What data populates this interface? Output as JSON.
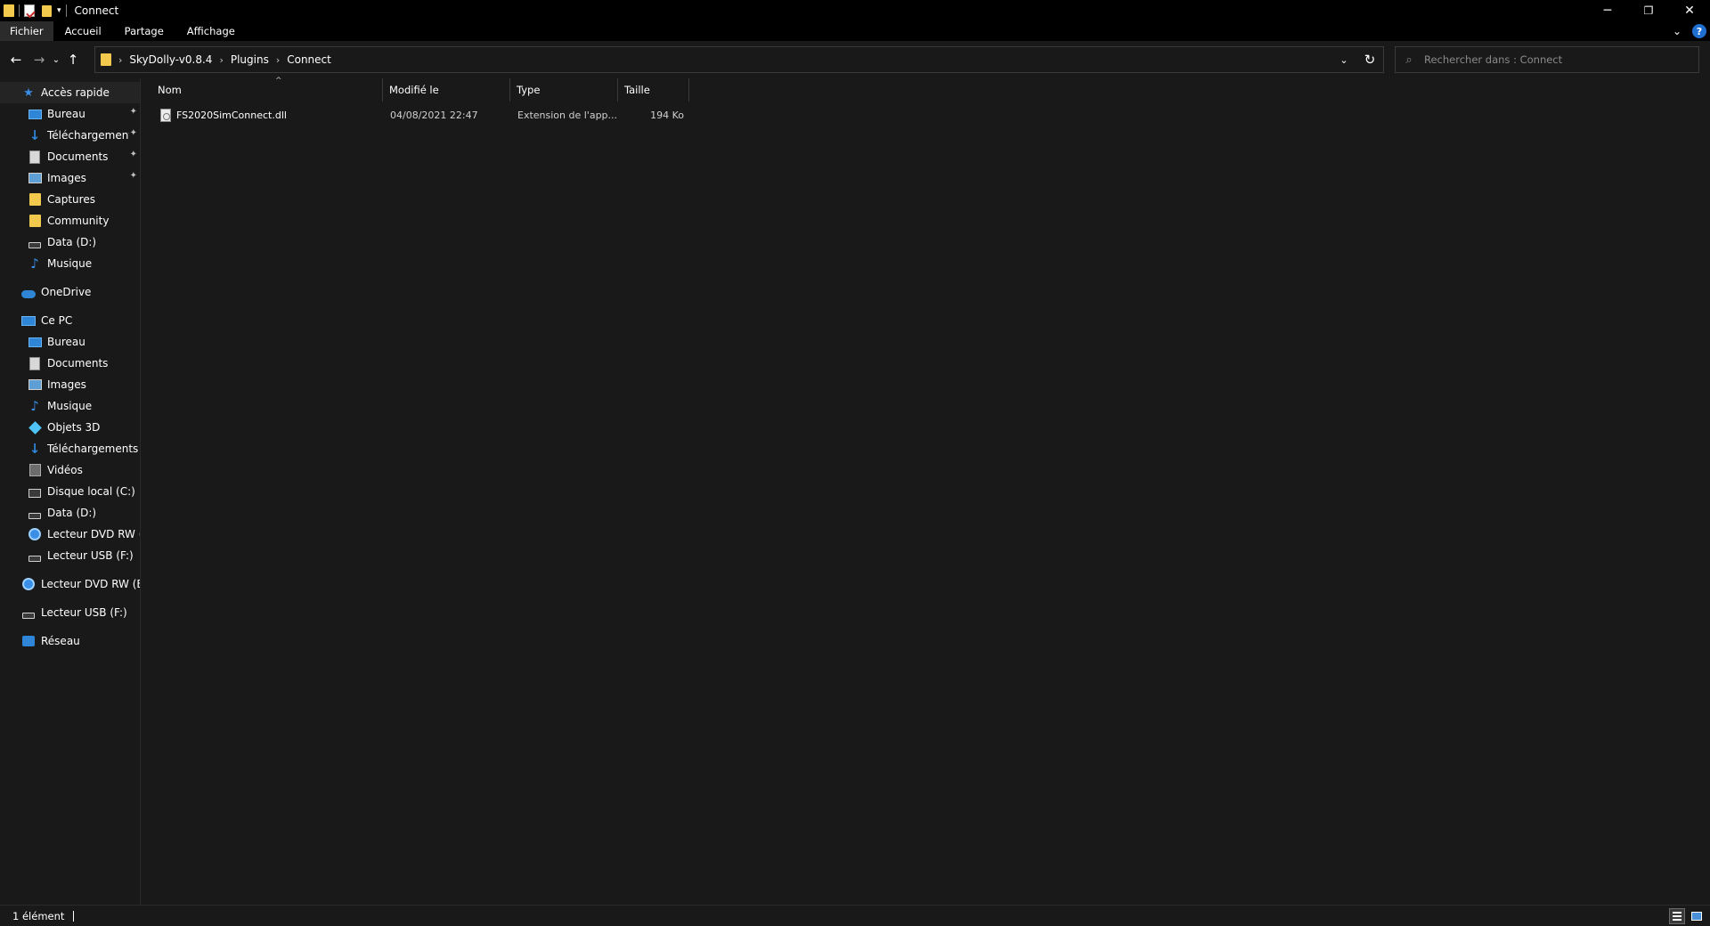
{
  "window": {
    "title": "Connect",
    "controls": {
      "minimize": "─",
      "restore": "❐",
      "close": "✕"
    }
  },
  "ribbon": {
    "tabs": [
      "Fichier",
      "Accueil",
      "Partage",
      "Affichage"
    ],
    "active_tab": "Fichier",
    "expand_glyph": "⌄",
    "help_glyph": "?"
  },
  "nav": {
    "back": "←",
    "forward": "→",
    "recent": "⌄",
    "up": "↑",
    "breadcrumb": [
      "SkyDolly-v0.8.4",
      "Plugins",
      "Connect"
    ],
    "breadcrumb_sep": "›",
    "dropdown": "⌄",
    "refresh": "↻"
  },
  "search": {
    "placeholder": "Rechercher dans : Connect",
    "icon": "⌕"
  },
  "sidebar": {
    "quick_access": {
      "label": "Accès rapide",
      "items": [
        {
          "label": "Bureau",
          "icon": "desktop-icon",
          "pinned": true
        },
        {
          "label": "Téléchargements",
          "icon": "download-icon",
          "pinned": true
        },
        {
          "label": "Documents",
          "icon": "documents-icon",
          "pinned": true
        },
        {
          "label": "Images",
          "icon": "images-icon",
          "pinned": true
        },
        {
          "label": "Captures",
          "icon": "folder-icon",
          "pinned": false
        },
        {
          "label": "Community",
          "icon": "folder-icon",
          "pinned": false
        },
        {
          "label": "Data (D:)",
          "icon": "drive-icon",
          "pinned": false
        },
        {
          "label": "Musique",
          "icon": "music-icon",
          "pinned": false
        }
      ]
    },
    "onedrive": {
      "label": "OneDrive"
    },
    "this_pc": {
      "label": "Ce PC",
      "items": [
        {
          "label": "Bureau"
        },
        {
          "label": "Documents"
        },
        {
          "label": "Images"
        },
        {
          "label": "Musique"
        },
        {
          "label": "Objets 3D"
        },
        {
          "label": "Téléchargements"
        },
        {
          "label": "Vidéos"
        },
        {
          "label": "Disque local (C:)"
        },
        {
          "label": "Data (D:)"
        },
        {
          "label": "Lecteur DVD RW (E:)"
        },
        {
          "label": "Lecteur USB (F:)"
        }
      ]
    },
    "dvd_drive": {
      "label": "Lecteur DVD RW (E:) I"
    },
    "usb_drive": {
      "label": "Lecteur USB (F:)"
    },
    "network": {
      "label": "Réseau"
    },
    "pin_glyph": "📌"
  },
  "file_list": {
    "columns": [
      "Nom",
      "Modifié le",
      "Type",
      "Taille"
    ],
    "sort_glyph": "^",
    "rows": [
      {
        "name": "FS2020SimConnect.dll",
        "modified": "04/08/2021 22:47",
        "type": "Extension de l'app...",
        "size": "194 Ko"
      }
    ]
  },
  "status": {
    "item_count": "1 élément"
  }
}
